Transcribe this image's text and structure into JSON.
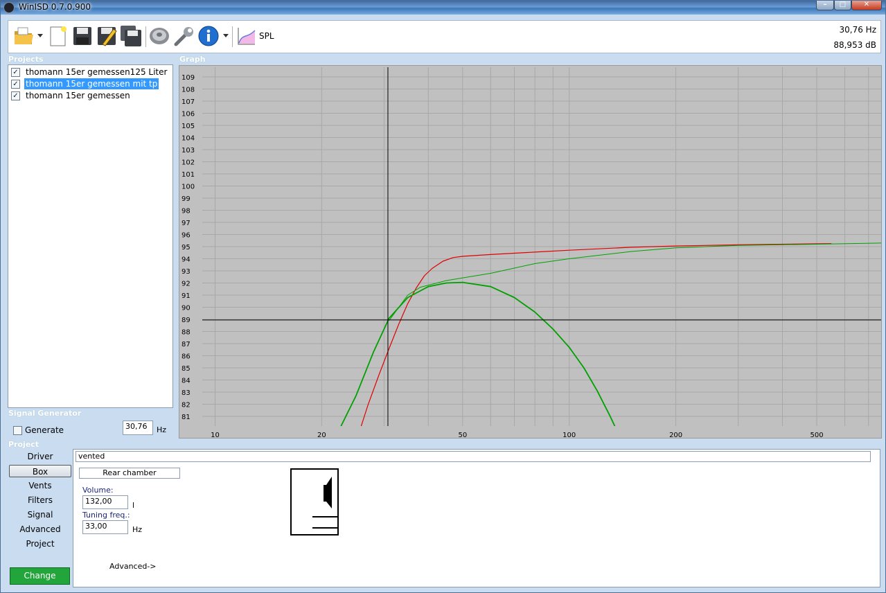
{
  "window": {
    "title": "WinISD 0.7.0.900",
    "min_glyph": "–",
    "max_glyph": "□",
    "close_glyph": "✕"
  },
  "toolbar": {
    "icons": [
      "open-folder-icon",
      "new-document-icon",
      "save-icon",
      "save-edit-icon",
      "save-all-icon",
      "driver-speaker-icon",
      "tools-wrench-icon",
      "info-icon",
      "spl-graph-icon"
    ],
    "spl_label": "SPL"
  },
  "readout": {
    "frequency": "30,76 Hz",
    "level": "88,953 dB"
  },
  "projects": {
    "label": "Projects",
    "items": [
      {
        "name": "thomann 15er gemessen125 Liter",
        "checked": true,
        "selected": false
      },
      {
        "name": "thomann 15er gemessen mit tp",
        "checked": true,
        "selected": true
      },
      {
        "name": "thomann 15er gemessen",
        "checked": true,
        "selected": false
      }
    ]
  },
  "graph": {
    "label": "Graph"
  },
  "signal_generator": {
    "label": "Signal Generator",
    "generate_label": "Generate",
    "frequency_value": "30,76",
    "unit": "Hz"
  },
  "project_panel": {
    "label": "Project",
    "nav": [
      "Driver",
      "Box",
      "Vents",
      "Filters",
      "Signal",
      "Advanced",
      "Project"
    ],
    "active_nav": "Box",
    "change_label": "Change",
    "box_type_value": "vented",
    "rear_chamber_label": "Rear chamber",
    "volume_label": "Volume:",
    "volume_value": "132,00",
    "volume_unit": "l",
    "tuning_label": "Tuning freq.:",
    "tuning_value": "33,00",
    "tuning_unit": "Hz",
    "advanced_link": "Advanced->"
  },
  "chart_data": {
    "type": "line",
    "xscale": "log",
    "xlim": [
      9.2,
      760
    ],
    "ylim": [
      80.2,
      109.8
    ],
    "x_ticks": [
      10,
      20,
      50,
      100,
      200,
      500
    ],
    "y_ticks": [
      81,
      82,
      83,
      84,
      85,
      86,
      87,
      88,
      89,
      90,
      91,
      92,
      93,
      94,
      95,
      96,
      97,
      98,
      99,
      100,
      101,
      102,
      103,
      104,
      105,
      106,
      107,
      108,
      109
    ],
    "cursor": {
      "x": 30.76,
      "y": 88.953
    },
    "colors": {
      "background": "#c0c0c0",
      "grid": "#a8a8a8",
      "cursor": "#000000"
    },
    "series": [
      {
        "color": "#e00000",
        "width": 1.2,
        "points": [
          [
            25.4,
            79.5
          ],
          [
            27,
            81.9
          ],
          [
            29,
            84.4
          ],
          [
            31,
            86.6
          ],
          [
            33,
            88.6
          ],
          [
            35,
            90.3
          ],
          [
            37,
            91.6
          ],
          [
            39,
            92.6
          ],
          [
            41,
            93.2
          ],
          [
            44,
            93.8
          ],
          [
            47,
            94.1
          ],
          [
            50,
            94.2
          ],
          [
            60,
            94.35
          ],
          [
            80,
            94.55
          ],
          [
            100,
            94.7
          ],
          [
            150,
            94.95
          ],
          [
            200,
            95.05
          ],
          [
            300,
            95.15
          ],
          [
            550,
            95.25
          ]
        ]
      },
      {
        "color": "#00a000",
        "width": 1,
        "points": [
          [
            31,
            88.9
          ],
          [
            35,
            91.0
          ],
          [
            38,
            91.65
          ],
          [
            45,
            92.2
          ],
          [
            60,
            92.8
          ],
          [
            80,
            93.6
          ],
          [
            100,
            94.0
          ],
          [
            150,
            94.6
          ],
          [
            200,
            94.9
          ],
          [
            300,
            95.1
          ],
          [
            500,
            95.2
          ],
          [
            760,
            95.3
          ]
        ]
      },
      {
        "color": "#00a000",
        "width": 1.8,
        "points": [
          [
            22.5,
            80.0
          ],
          [
            25,
            82.7
          ],
          [
            28,
            86.3
          ],
          [
            31,
            89.1
          ],
          [
            35,
            90.8
          ],
          [
            40,
            91.7
          ],
          [
            45,
            92.0
          ],
          [
            50,
            92.05
          ],
          [
            60,
            91.7
          ],
          [
            70,
            90.8
          ],
          [
            80,
            89.6
          ],
          [
            90,
            88.2
          ],
          [
            100,
            86.7
          ],
          [
            110,
            85.0
          ],
          [
            120,
            83.1
          ],
          [
            130,
            81.1
          ],
          [
            135,
            80.1
          ]
        ]
      }
    ]
  }
}
